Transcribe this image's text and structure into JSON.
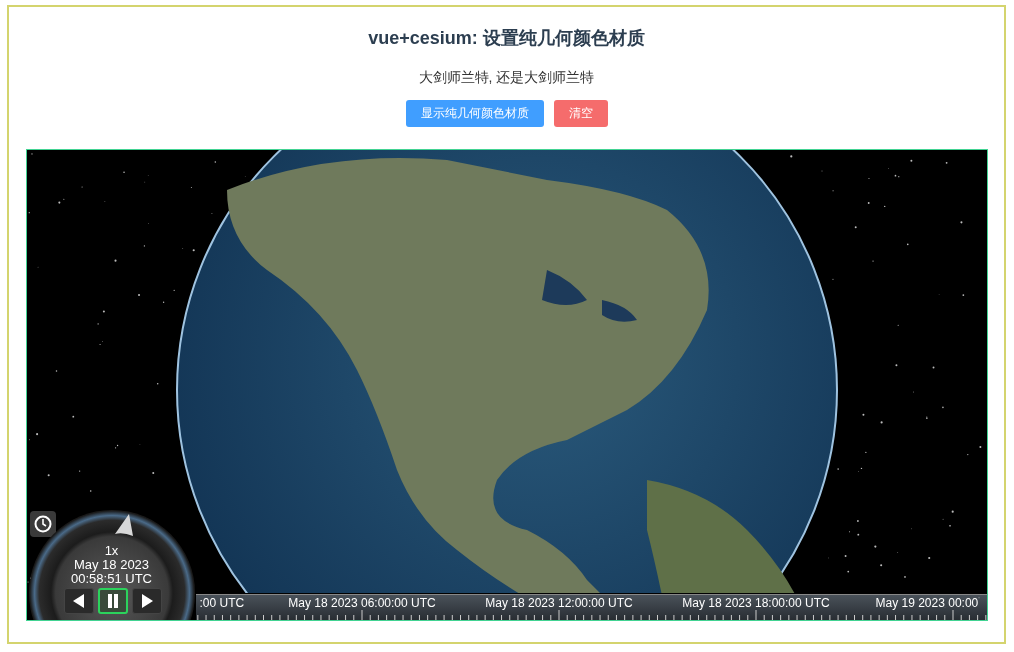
{
  "title": "vue+cesium: 设置纯几何颜色材质",
  "subtitle": "大剑师兰特, 还是大剑师兰特",
  "buttons": [
    {
      "label": "显示纯几何颜色材质",
      "kind": "primary"
    },
    {
      "label": "清空",
      "kind": "danger"
    }
  ],
  "viewer": {
    "animation": {
      "speed": "1x",
      "date": "May 18 2023",
      "time": "00:58:51 UTC",
      "controls": [
        {
          "kind": "reverse",
          "selected": false
        },
        {
          "kind": "pause",
          "selected": true
        },
        {
          "kind": "play",
          "selected": false
        }
      ]
    },
    "timeline": {
      "labels": [
        ":00 UTC",
        "May 18 2023 06:00:00 UTC",
        "May 18 2023 12:00:00 UTC",
        "May 18 2023 18:00:00 UTC",
        "May 19 2023 00:00"
      ]
    }
  }
}
